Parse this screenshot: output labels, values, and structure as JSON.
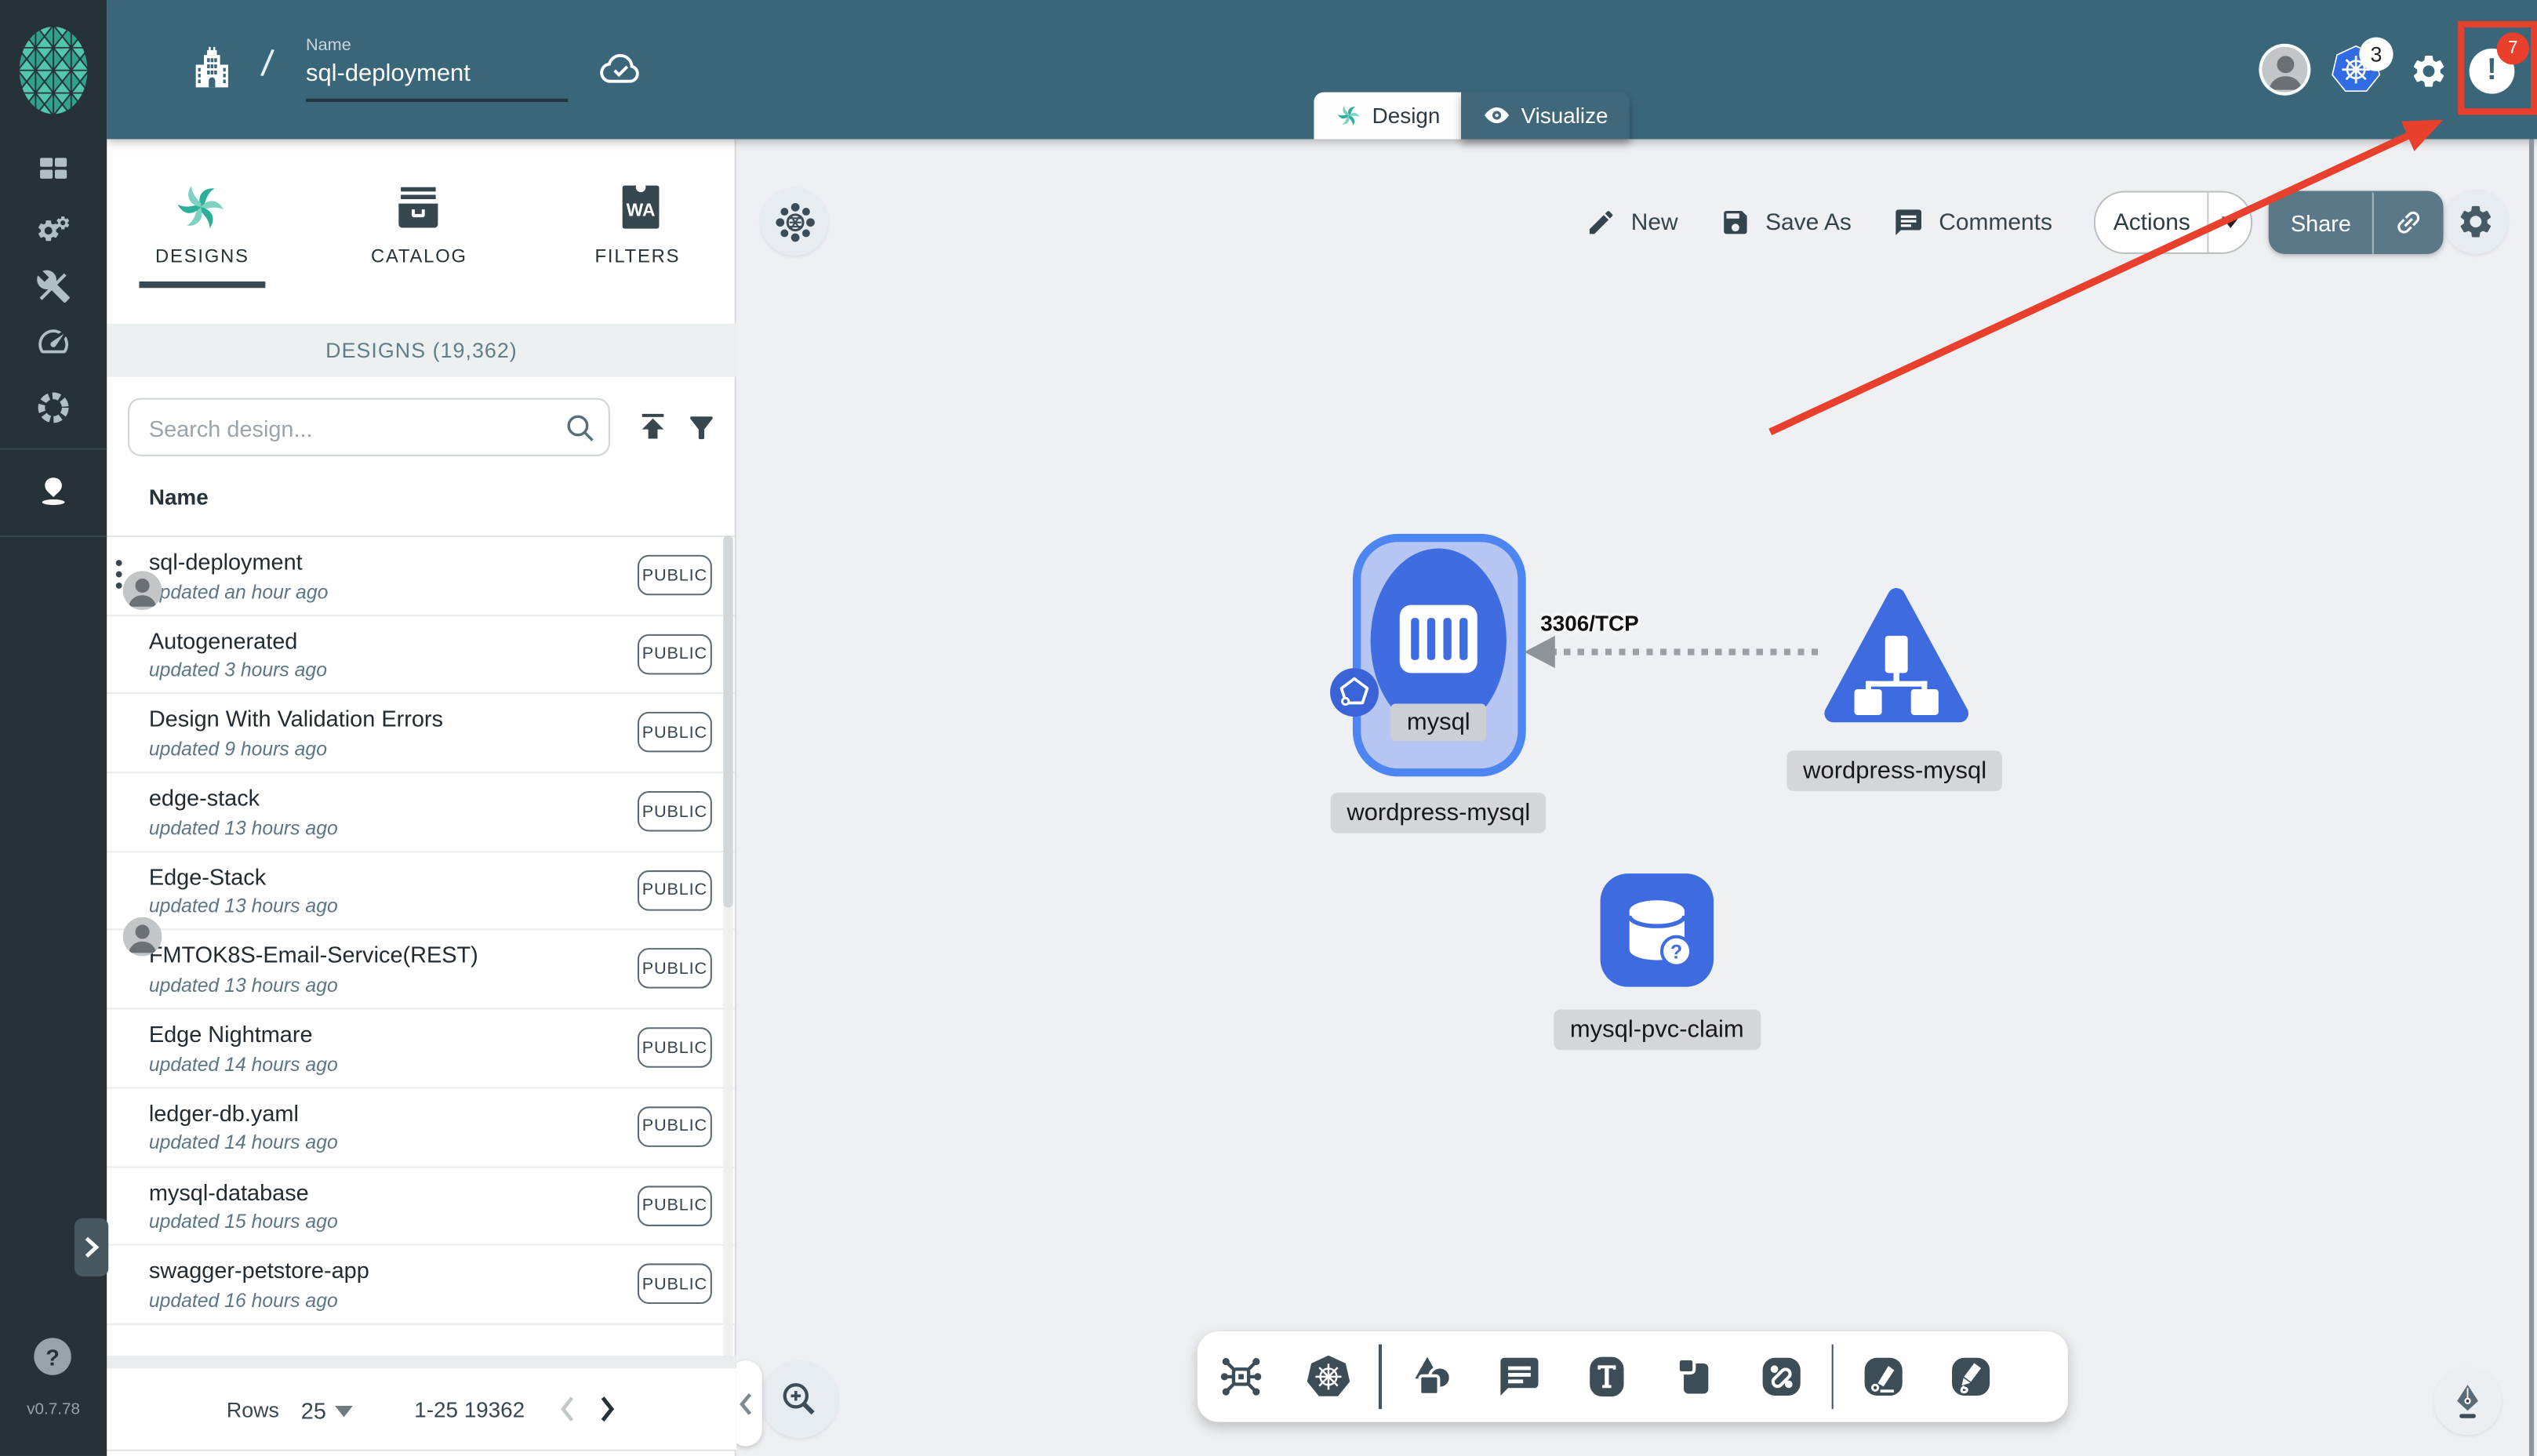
{
  "header": {
    "name_label": "Name",
    "name_value": "sql-deployment",
    "breadcrumb_separator": "/",
    "tabs": [
      {
        "label": "Design"
      },
      {
        "label": "Visualize"
      }
    ],
    "kubernetes_badge": "3",
    "notification_badge": "7",
    "notification_glyph": "!"
  },
  "sidebar": {
    "help_glyph": "?",
    "version": "v0.7.78"
  },
  "panel": {
    "tabs": [
      {
        "label": "DESIGNS"
      },
      {
        "label": "CATALOG"
      },
      {
        "label": "FILTERS",
        "icon_text": "WA"
      }
    ],
    "section_title": "DESIGNS (19,362)",
    "search_placeholder": "Search design...",
    "column_header": "Name",
    "rows": [
      {
        "name": "sql-deployment",
        "updated": "updated an hour ago",
        "badge": "PUBLIC",
        "menu": true,
        "avatar": "inline"
      },
      {
        "name": "Autogenerated",
        "updated": "updated 3 hours ago",
        "badge": "PUBLIC"
      },
      {
        "name": "Design With Validation Errors",
        "updated": "updated 9 hours ago",
        "badge": "PUBLIC"
      },
      {
        "name": "edge-stack",
        "updated": "updated 13 hours ago",
        "badge": "PUBLIC"
      },
      {
        "name": "Edge-Stack",
        "updated": "updated 13 hours ago",
        "badge": "PUBLIC",
        "avatar": "bottom"
      },
      {
        "name": "FMTOK8S-Email-Service(REST)",
        "updated": "updated 13 hours ago",
        "badge": "PUBLIC"
      },
      {
        "name": "Edge Nightmare",
        "updated": "updated 14 hours ago",
        "badge": "PUBLIC"
      },
      {
        "name": "ledger-db.yaml",
        "updated": "updated 14 hours ago",
        "badge": "PUBLIC"
      },
      {
        "name": "mysql-database",
        "updated": "updated 15 hours ago",
        "badge": "PUBLIC"
      },
      {
        "name": "swagger-petstore-app",
        "updated": "updated 16 hours ago",
        "badge": "PUBLIC"
      }
    ],
    "pagination": {
      "rows_label": "Rows",
      "per_page": "25",
      "range": "1-25 19362"
    }
  },
  "canvas": {
    "toolbar": {
      "new": "New",
      "save_as": "Save As",
      "comments": "Comments",
      "actions": "Actions",
      "share": "Share"
    },
    "nodes": {
      "deployment": {
        "inner_label": "mysql",
        "label": "wordpress-mysql"
      },
      "service": {
        "label": "wordpress-mysql"
      },
      "pvc": {
        "label": "mysql-pvc-claim",
        "badge_glyph": "?"
      }
    },
    "edge": {
      "label": "3306/TCP"
    }
  },
  "colors": {
    "header": "#396679",
    "rail": "#263238",
    "accent": "#00B39F",
    "node_blue": "#3E6CE0",
    "annotation_red": "#E8402C"
  }
}
